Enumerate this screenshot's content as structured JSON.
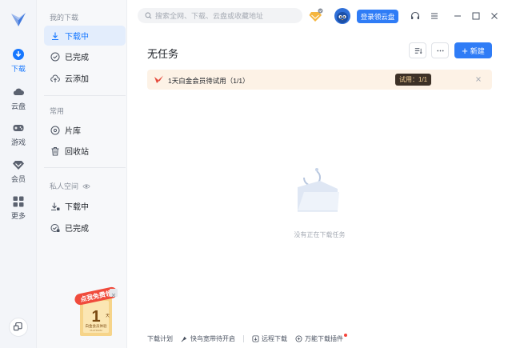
{
  "rail": {
    "items": [
      {
        "label": "下载",
        "icon": "download-icon",
        "active": true
      },
      {
        "label": "云盘",
        "icon": "cloud-icon",
        "active": false
      },
      {
        "label": "游戏",
        "icon": "gamepad-icon",
        "active": false
      },
      {
        "label": "会员",
        "icon": "diamond-icon",
        "active": false
      },
      {
        "label": "更多",
        "icon": "grid-icon",
        "active": false
      }
    ]
  },
  "side": {
    "my_downloads_title": "我的下载",
    "items": [
      {
        "label": "下载中",
        "icon": "download-arrow-icon",
        "active": true
      },
      {
        "label": "已完成",
        "icon": "check-circle-icon",
        "active": false
      },
      {
        "label": "云添加",
        "icon": "cloud-upload-icon",
        "active": false
      }
    ],
    "common_title": "常用",
    "common_items": [
      {
        "label": "片库",
        "icon": "film-library-icon"
      },
      {
        "label": "回收站",
        "icon": "trash-icon"
      }
    ],
    "private_title": "私人空间",
    "private_items": [
      {
        "label": "下载中",
        "icon": "private-download-icon"
      },
      {
        "label": "已完成",
        "icon": "private-check-icon"
      }
    ],
    "promo": {
      "ribbon": "点我免费领",
      "big": "1",
      "unit": "天",
      "caption": "白金会员体验",
      "en": "PLATINUM"
    }
  },
  "top": {
    "search_placeholder": "搜索全网、下载、云盘或收藏地址",
    "login_label": "登录领云盘"
  },
  "main": {
    "title": "无任务",
    "new_label": "新建",
    "banner_text": "1天白金会员待试用（1/1）",
    "banner_badge": "试用：1/1",
    "empty_text": "没有正在下载任务"
  },
  "footer": {
    "items": [
      "下载计划",
      "快鸟宽带待开启",
      "远程下载",
      "万能下载插件"
    ]
  },
  "colors": {
    "accent": "#2f7cf6",
    "active_bg": "#e3edfc",
    "banner_bg": "#fdf2e6",
    "red_dot": "#f5433a"
  }
}
